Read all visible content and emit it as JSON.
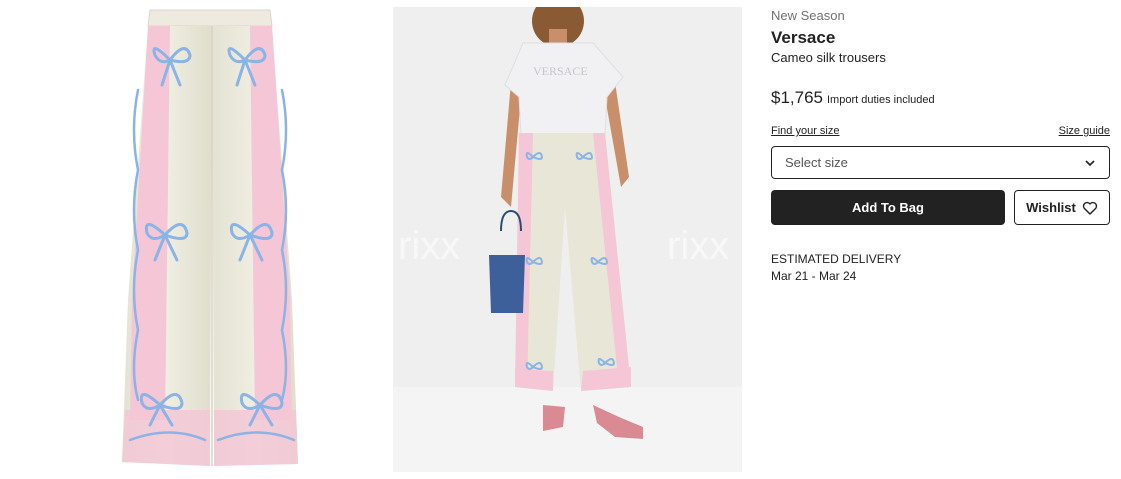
{
  "gallery": {
    "watermark": "rixx",
    "images": [
      {
        "alt": "Cameo silk trousers product shot",
        "icon": "trousers-image"
      },
      {
        "alt": "Model wearing Cameo silk trousers",
        "icon": "model-image"
      }
    ],
    "model_tshirt_text": "VERSACE"
  },
  "product": {
    "badge": "New Season",
    "brand": "Versace",
    "name": "Cameo silk trousers",
    "price": "$1,765",
    "duties_note": "Import duties included",
    "find_size_label": "Find your size",
    "size_guide_label": "Size guide",
    "size_select_placeholder": "Select size",
    "add_to_bag_label": "Add To Bag",
    "wishlist_label": "Wishlist",
    "delivery_heading": "ESTIMATED DELIVERY",
    "delivery_dates": "Mar 21 - Mar 24"
  },
  "colors": {
    "primary": "#222222",
    "pink_panel": "#f4c6d6",
    "cream": "#eae8d8",
    "ribbon_blue": "#8bb4e6"
  }
}
